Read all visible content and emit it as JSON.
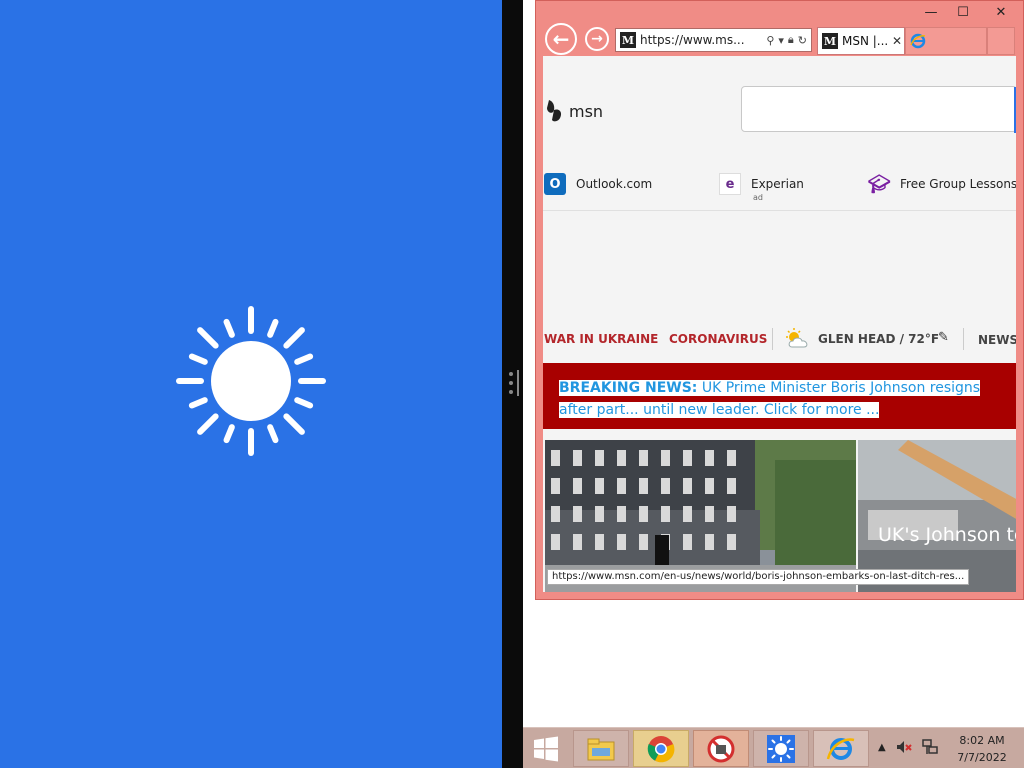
{
  "weather_app": {
    "icon": "sun-icon",
    "background": "#2a72e6"
  },
  "browser": {
    "address": {
      "url_display": "https://www.ms..."
    },
    "tabs": [
      {
        "label": "MSN |...",
        "active": true
      }
    ],
    "window_controls": {
      "minimize": "—",
      "maximize": "☐",
      "close": "✕"
    },
    "colors": {
      "frame": "#f08c86"
    }
  },
  "msn": {
    "logo_text": "msn",
    "quicklinks": [
      {
        "label": "Outlook.com",
        "icon": "outlook-icon"
      },
      {
        "label": "Experian",
        "icon": "experian-icon",
        "badge": "ad"
      },
      {
        "label": "Free Group Lessons",
        "icon": "graduation-cap-icon"
      }
    ],
    "topics": {
      "ukraine": "WAR IN UKRAINE",
      "coronavirus": "CORONAVIRUS",
      "weather": "GLEN HEAD / 72°F",
      "news": "NEWS"
    },
    "breaking": {
      "label": "BREAKING NEWS:",
      "text": " UK Prime Minister Boris Johnson resigns after part... until new leader. Click for more ..."
    },
    "stories": [
      {
        "title": "",
        "image": "downing-street-photo"
      },
      {
        "title": "UK's Johnson to Mississippi abor",
        "image": "crane-photo"
      }
    ],
    "status_url": "https://www.msn.com/en-us/news/world/boris-johnson-embarks-on-last-ditch-res..."
  },
  "taskbar": {
    "items": [
      "file-explorer-icon",
      "chrome-icon",
      "blocked-app-icon",
      "weather-app-icon",
      "internet-explorer-icon"
    ],
    "clock": {
      "time": "8:02 AM",
      "date": "7/7/2022"
    },
    "color": "#c7a9a0"
  }
}
